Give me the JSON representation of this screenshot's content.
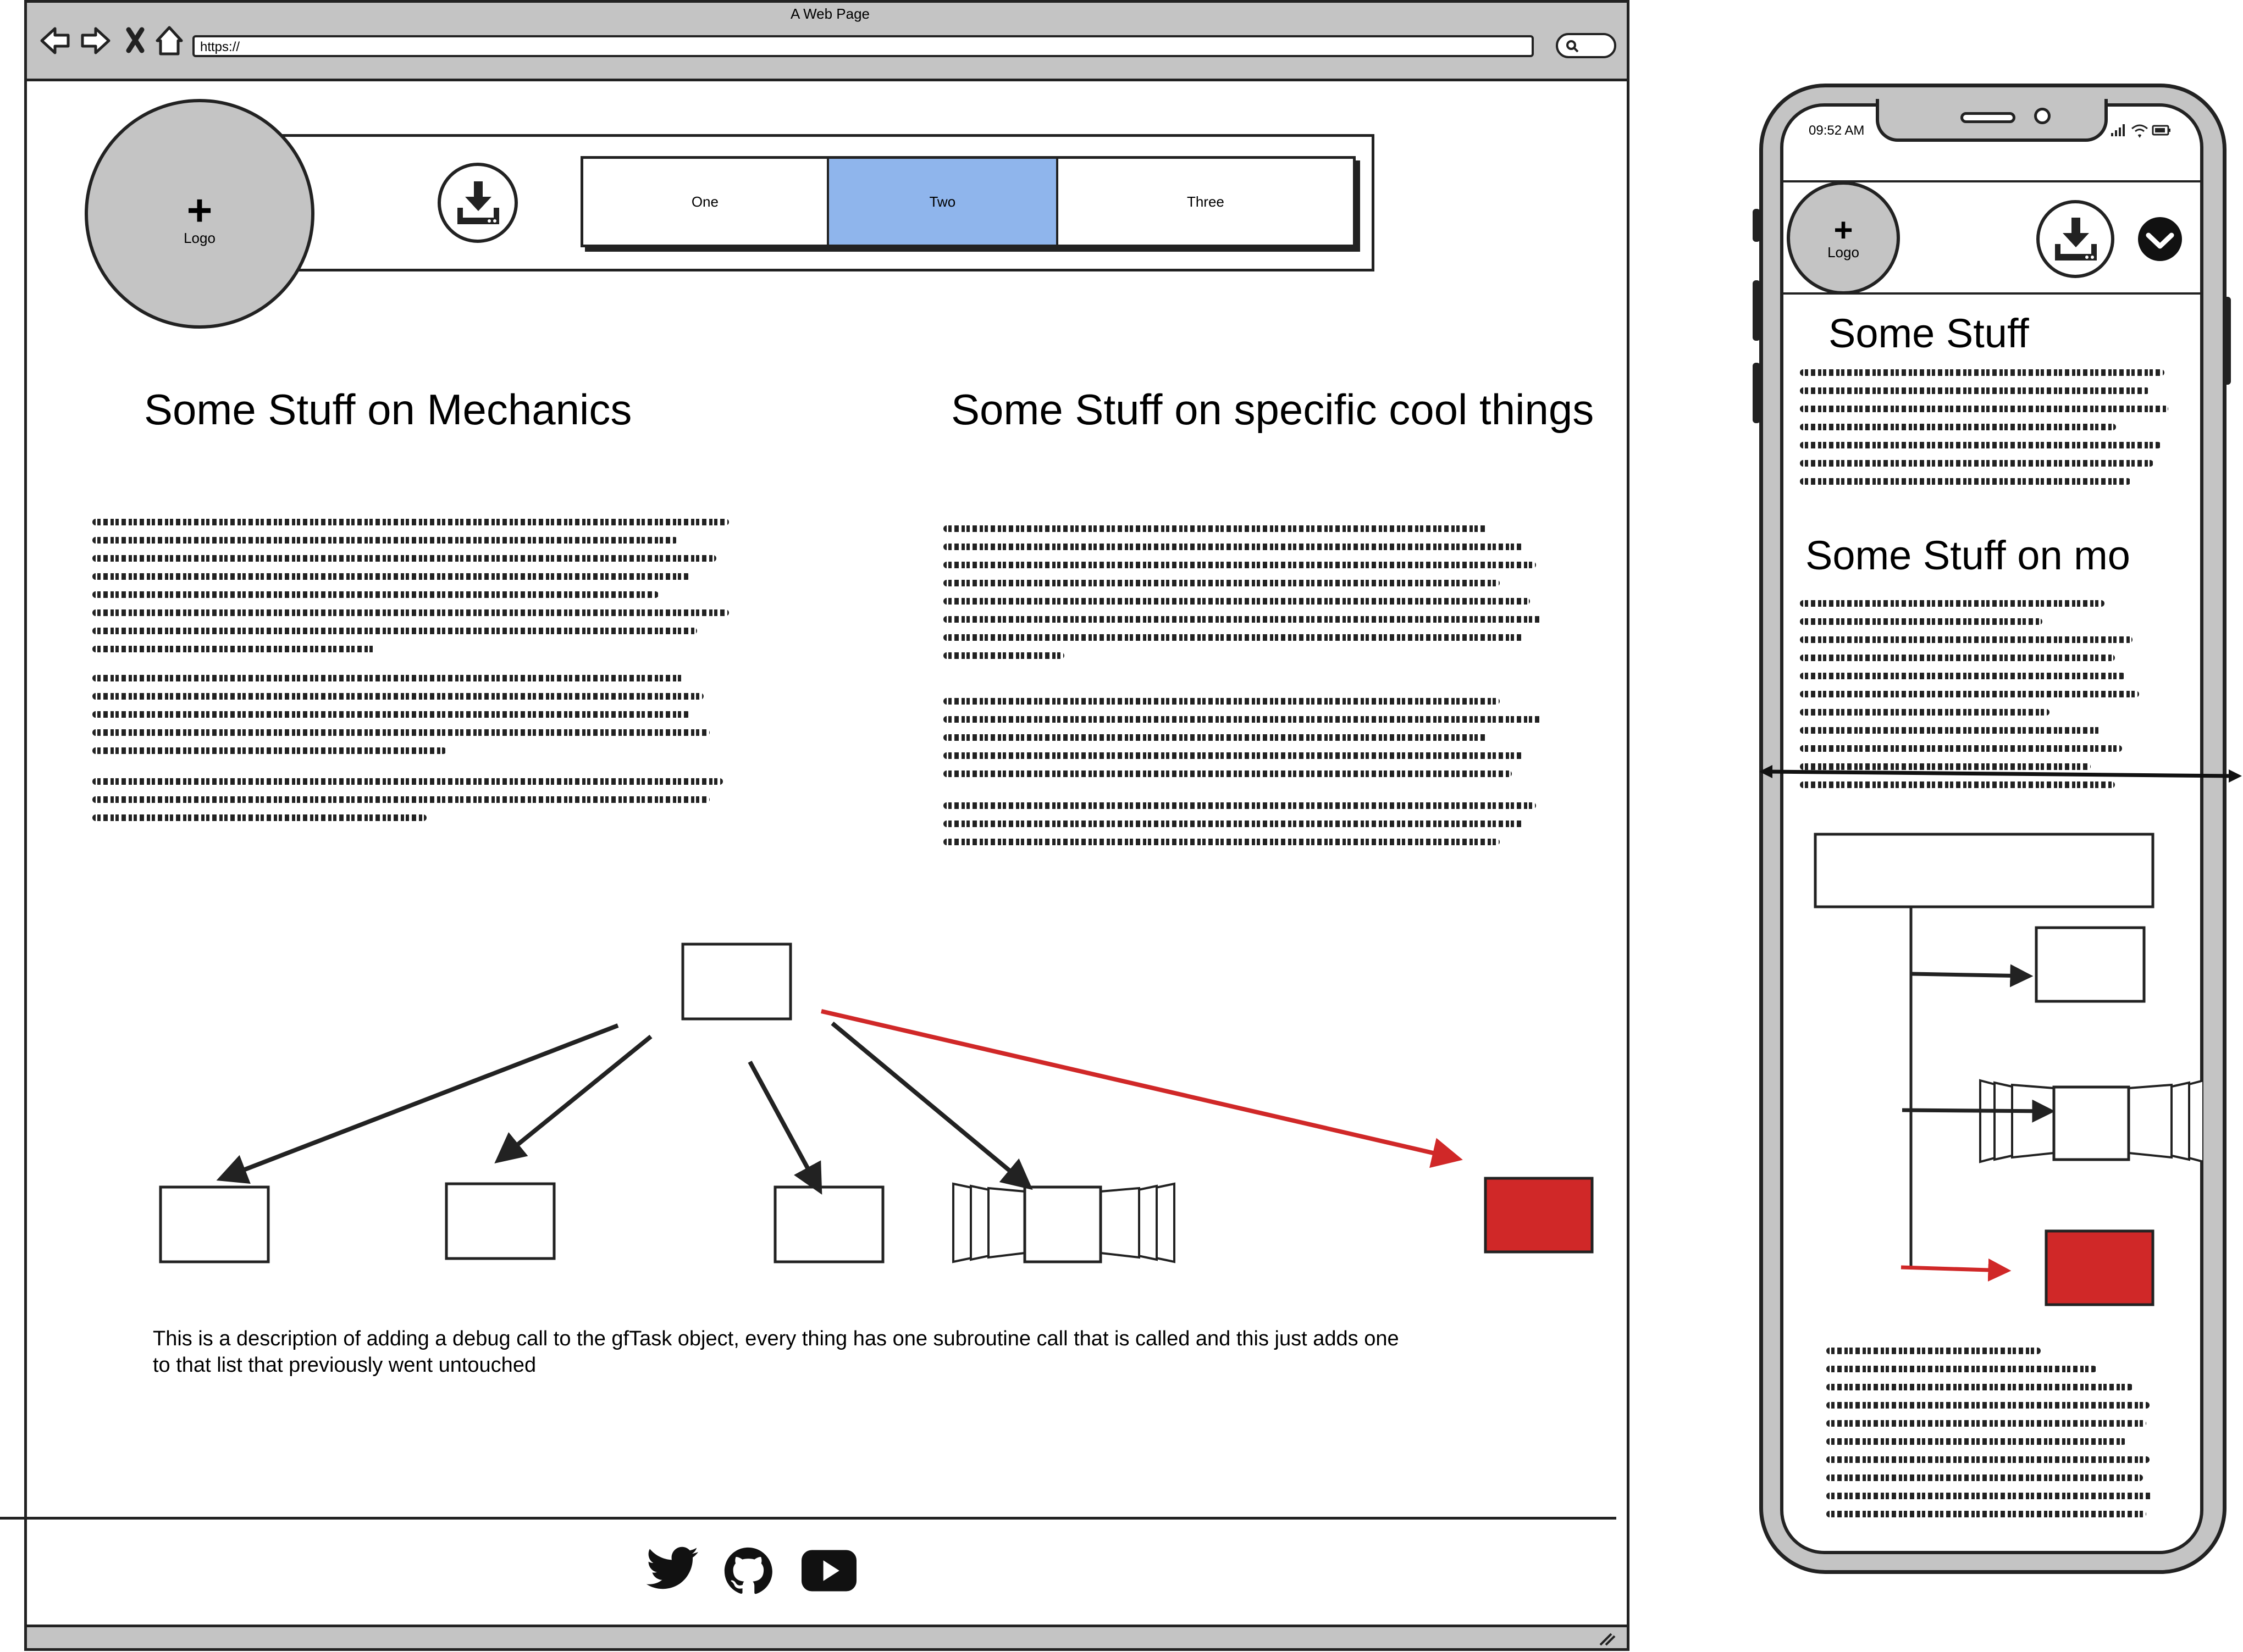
{
  "browser": {
    "window_title": "A Web Page",
    "url": "https://",
    "nav_icons": [
      "back-icon",
      "forward-icon",
      "close-icon",
      "home-icon"
    ],
    "search_icon": "search-icon"
  },
  "header": {
    "logo_plus": "+",
    "logo_label": "Logo",
    "download_icon": "download-icon",
    "tabs": [
      {
        "label": "One",
        "selected": false
      },
      {
        "label": "Two",
        "selected": true
      },
      {
        "label": "Three",
        "selected": false
      }
    ],
    "selected_tab_color": "#8fb5ec"
  },
  "main": {
    "left_heading": "Some Stuff on Mechanics",
    "right_heading": "Some Stuff on specific cool things",
    "description": "This is a description of adding a debug call to the gfTask object, every thing has one subroutine call that is called and this just adds one to that list that previously went untouched"
  },
  "diagram": {
    "accent_color": "#d02828",
    "stroke_color": "#222222"
  },
  "footer": {
    "social_icons": [
      "twitter-icon",
      "github-icon",
      "youtube-icon"
    ]
  },
  "phone": {
    "time": "09:52 AM",
    "status_icons": [
      "signal-icon",
      "wifi-icon",
      "battery-icon"
    ],
    "logo_plus": "+",
    "logo_label": "Logo",
    "download_icon": "download-icon",
    "menu_icon": "chevron-down-circle-icon",
    "heading_1": "Some Stuff",
    "heading_2": "Some Stuff on mo"
  }
}
